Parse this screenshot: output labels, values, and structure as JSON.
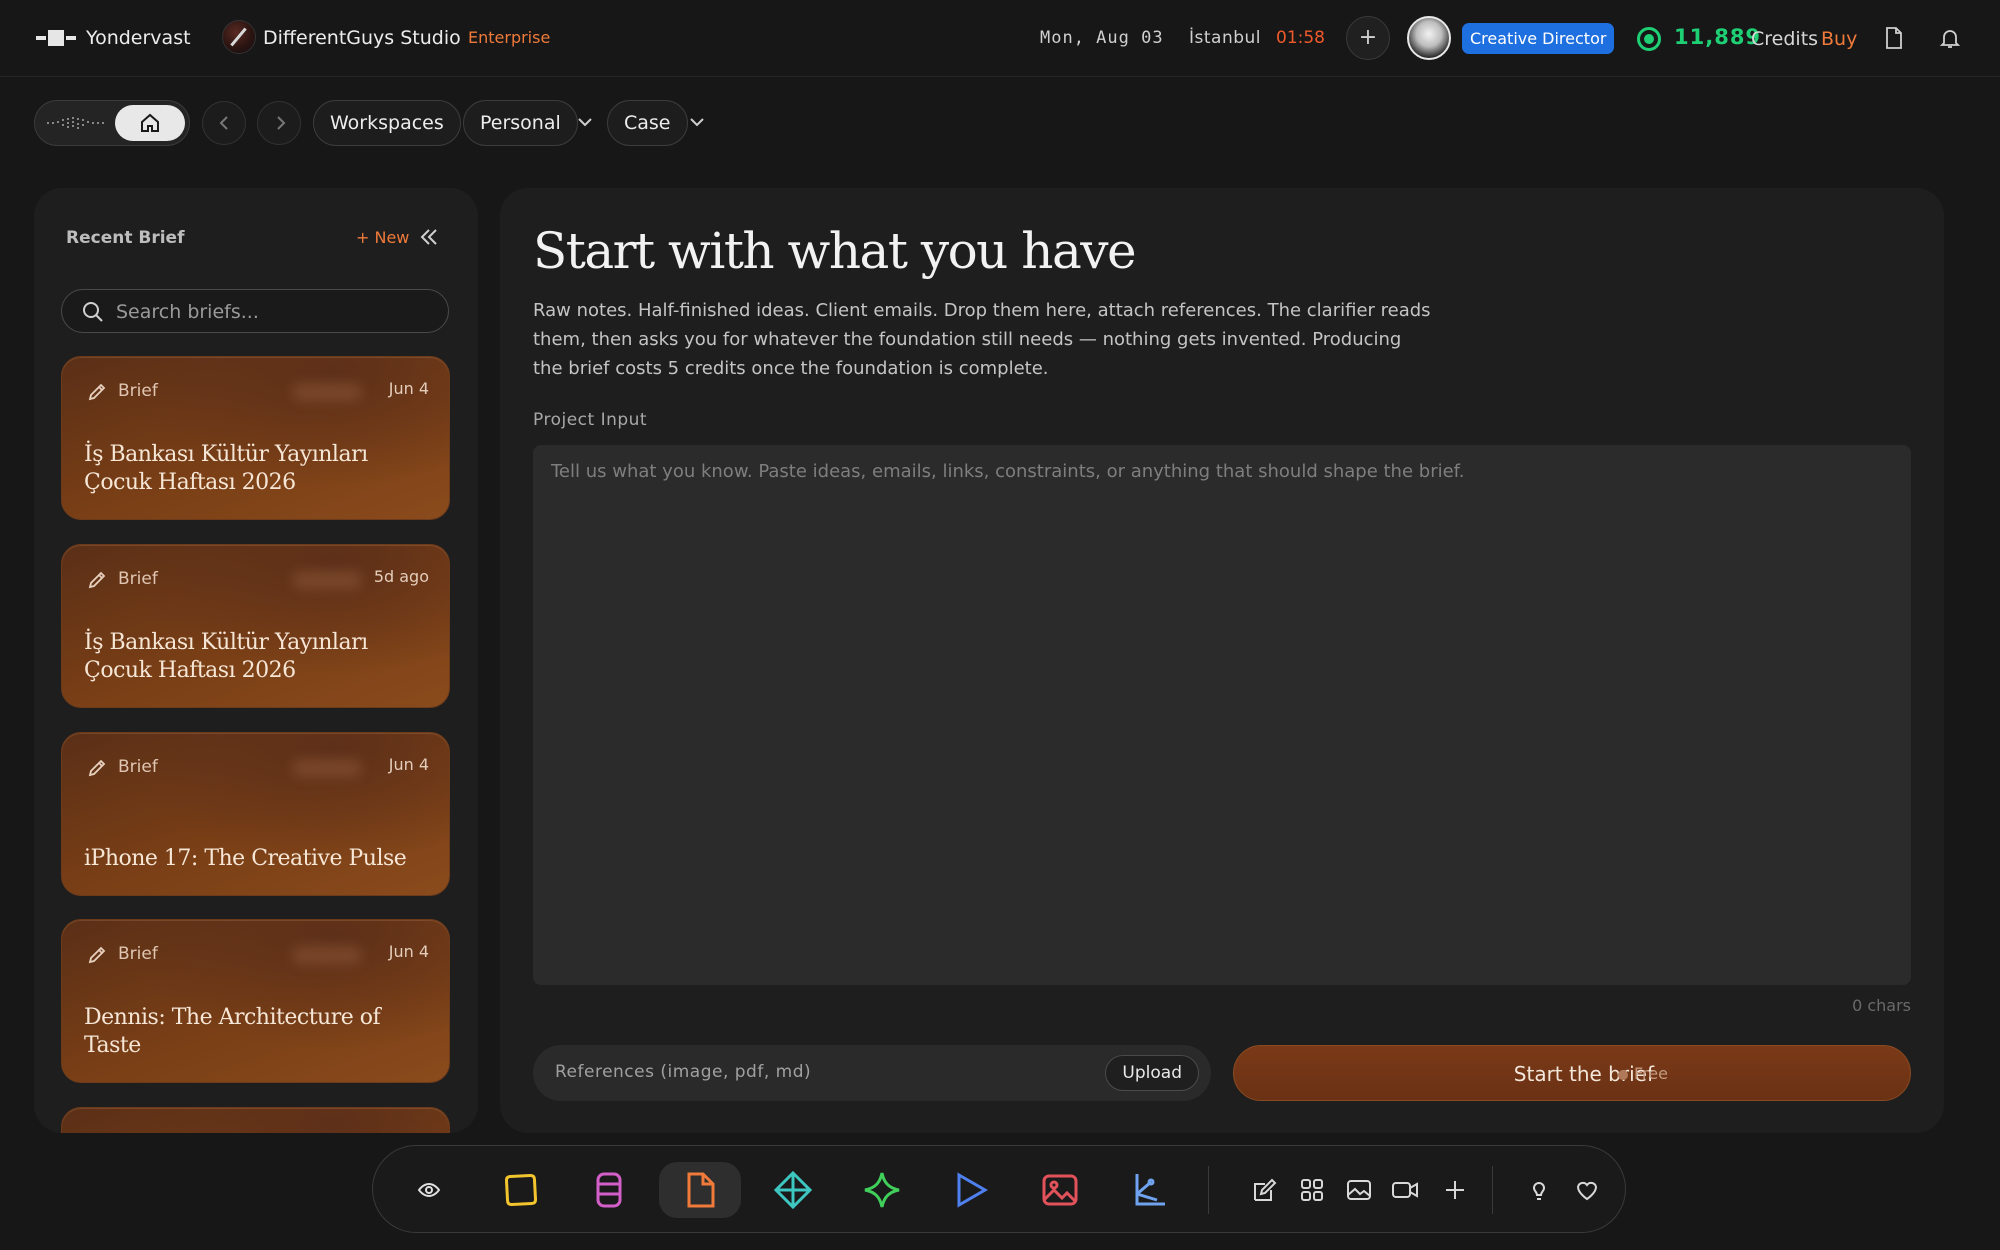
{
  "topbar": {
    "app_name": "Yondervast",
    "studio_name": "DifferentGuys Studio",
    "plan": "Enterprise",
    "date": "Mon, Aug 03",
    "city": "İstanbul",
    "time": "01:58",
    "role": "Creative Director",
    "credits": "11,889",
    "credits_label": "Credits",
    "buy_label": "Buy"
  },
  "breadcrumb": {
    "workspaces": "Workspaces",
    "personal": "Personal",
    "case": "Case"
  },
  "sidebar": {
    "title": "Recent Brief",
    "new_label": "+ New",
    "search_placeholder": "Search briefs...",
    "briefs": [
      {
        "type": "Brief",
        "date": "Jun 4",
        "title": "İş Bankası Kültür Yayınları Çocuk Haftası 2026"
      },
      {
        "type": "Brief",
        "date": "5d ago",
        "title": "İş Bankası Kültür Yayınları Çocuk Haftası 2026"
      },
      {
        "type": "Brief",
        "date": "Jun 4",
        "title": "iPhone 17: The Creative Pulse"
      },
      {
        "type": "Brief",
        "date": "Jun 4",
        "title": "Dennis: The Architecture of Taste"
      }
    ]
  },
  "main": {
    "heading": "Start with what you have",
    "description": "Raw notes. Half-finished ideas. Client emails. Drop them here, attach references. The clarifier reads them, then asks you for whatever the foundation still needs — nothing gets invented. Producing the brief costs 5 credits once the foundation is complete.",
    "input_label": "Project Input",
    "input_placeholder": "Tell us what you know. Paste ideas, emails, links, constraints, or anything that should shape the brief.",
    "char_count": "0 chars",
    "references_label": "References (image, pdf, md)",
    "upload_label": "Upload",
    "start_label": "Start the brief",
    "free_label": "Free"
  },
  "colors": {
    "accent": "#f07a3a",
    "credits": "#1ecf74",
    "role_badge": "#1e6fe0",
    "card": "#7a3f16"
  },
  "dock": {
    "icons": [
      "eye-icon",
      "square-icon",
      "database-icon",
      "document-icon",
      "diamond-icon",
      "sparkle-icon",
      "play-icon",
      "image-icon",
      "branch-icon",
      "edit-icon",
      "grid-icon",
      "picture-icon",
      "video-icon",
      "plus-icon",
      "bulb-icon",
      "heart-icon"
    ]
  }
}
